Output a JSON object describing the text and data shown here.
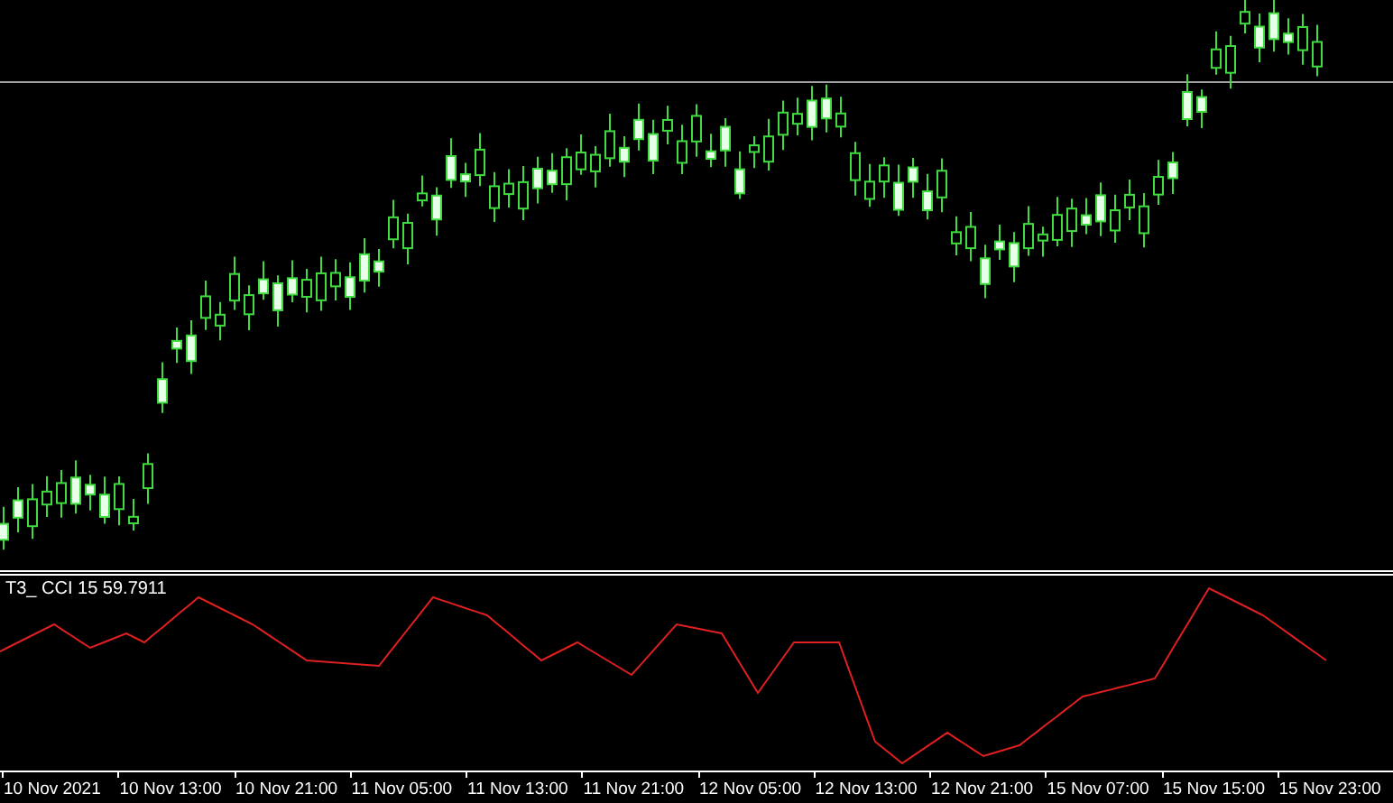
{
  "indicator": {
    "label": "T3_ CCI 15 59.7911"
  },
  "time_axis": [
    "10 Nov 2021",
    "10 Nov 13:00",
    "10 Nov 21:00",
    "11 Nov 05:00",
    "11 Nov 13:00",
    "11 Nov 21:00",
    "12 Nov 05:00",
    "12 Nov 13:00",
    "12 Nov 21:00",
    "15 Nov 07:00",
    "15 Nov 15:00",
    "15 Nov 23:00"
  ]
}
